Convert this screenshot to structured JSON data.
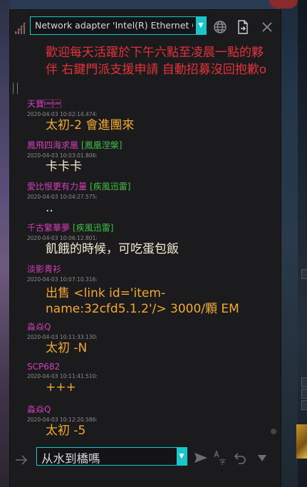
{
  "adapter": {
    "selected": "Network adapter 'Intel(R) Ethernet Co"
  },
  "chat": {
    "intro_text": "歡迎每天活躍於下午六點至凌晨一點的夥伴 右鍵門派支援申請 自動招募沒回抱歉o",
    "messages": [
      {
        "nick": "天寶\u0018\u0018",
        "tag": "",
        "timestamp": "2020-04-03 10:02:14.474:",
        "text": "太初-2 會進團來",
        "style": "orange"
      },
      {
        "nick": "鳳飛四海求凰",
        "tag": "[鳳凰涅槃]",
        "timestamp": "2020-04-03 10:03:01.806:",
        "text": "卡卡卡",
        "style": "light"
      },
      {
        "nick": "愛比恨更有力量",
        "tag": "[疾風迅雷]",
        "timestamp": "2020-04-03 10:04:27.575:",
        "text": "..",
        "style": "light"
      },
      {
        "nick": "千古繁華夢",
        "tag": "[疾風迅雷]",
        "timestamp": "2020-04-03 10:06:12.801:",
        "text": "飢餓的時候，可吃蛋包飯",
        "style": "light"
      },
      {
        "nick": "淡影青衫",
        "tag": "",
        "timestamp": "2020-04-03 10:07:10.316:",
        "text": "出售 <link id='item-name:32cfd5.1.2'/> 3000/顆 EM",
        "style": "orange"
      },
      {
        "nick": "淼焱Q",
        "tag": "",
        "timestamp": "2020-04-03 10:11:33.130:",
        "text": "太初 -N",
        "style": "orange"
      },
      {
        "nick": "SCP682",
        "tag": "",
        "timestamp": "2020-04-03 10:11:41.510:",
        "text": "+++",
        "style": "orange"
      },
      {
        "nick": "淼焱Q",
        "tag": "",
        "timestamp": "2020-04-03 10:12:20.586:",
        "text": "太初 -5",
        "style": "orange"
      }
    ]
  },
  "input": {
    "value": "从水到橋嗎"
  },
  "icons": {
    "signal": "signal-icon",
    "globe": "globe-icon",
    "export": "export-file-icon",
    "close": "close-icon",
    "send_arrow": "arrow-right-icon",
    "send": "send-icon",
    "translate": "translate-icon",
    "undo": "undo-icon",
    "more": "chevron-down-icon"
  },
  "colors": {
    "accent": "#19c6c9",
    "nick": "#d43fbb",
    "guild_tag": "#3fbf48",
    "message_orange": "#f3a832",
    "message_light": "#f3ecd2",
    "intro_red": "#e2323a"
  }
}
